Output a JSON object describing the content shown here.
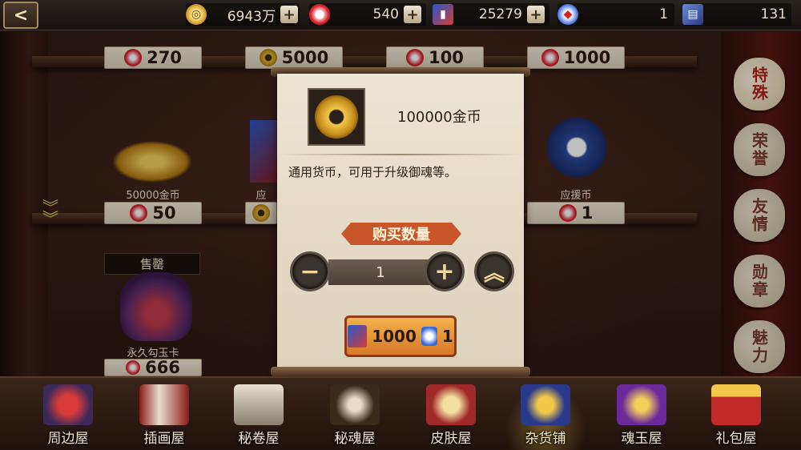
{
  "topbar": {
    "resources": [
      {
        "icon": "gold-coin-icon",
        "value": "6943万"
      },
      {
        "icon": "magatama-jade-icon",
        "value": "540"
      },
      {
        "icon": "blue-ticket-icon",
        "value": "25279"
      },
      {
        "icon": "charm-icon",
        "value": "1"
      },
      {
        "icon": "card-icon",
        "value": "131"
      }
    ],
    "plus": "+"
  },
  "back_glyph": "<",
  "shelf_top": {
    "prices": [
      "270",
      "5000",
      "100",
      "1000"
    ]
  },
  "shelf_mid": {
    "items": [
      {
        "name": "50000金币",
        "price": "50"
      },
      {
        "name": "应",
        "price": ""
      },
      {
        "name": "应援币",
        "price": "1"
      }
    ]
  },
  "shelf_bottom": {
    "items": [
      {
        "sold_tag": "售罄",
        "name": "永久勾玉卡",
        "price": "666"
      }
    ]
  },
  "side_tabs": [
    "特殊",
    "荣誉",
    "友情",
    "勋章",
    "魅力"
  ],
  "bottom_nav": [
    "周边屋",
    "插画屋",
    "秘卷屋",
    "秘魂屋",
    "皮肤屋",
    "杂货铺",
    "魂玉屋",
    "礼包屋"
  ],
  "dialog": {
    "item_name": "100000金币",
    "description": "通用货币，可用于升级御魂等。",
    "qty_header": "购买数量",
    "qty_value": "1",
    "cost_tickets": "1000",
    "cost_charm": "1",
    "minus_glyph": "−",
    "plus_glyph": "+",
    "max_glyph": "︽"
  },
  "colors": {
    "accent_orange": "#c8562a",
    "parchment": "#ece4d3",
    "gold": "#e8c66a"
  }
}
